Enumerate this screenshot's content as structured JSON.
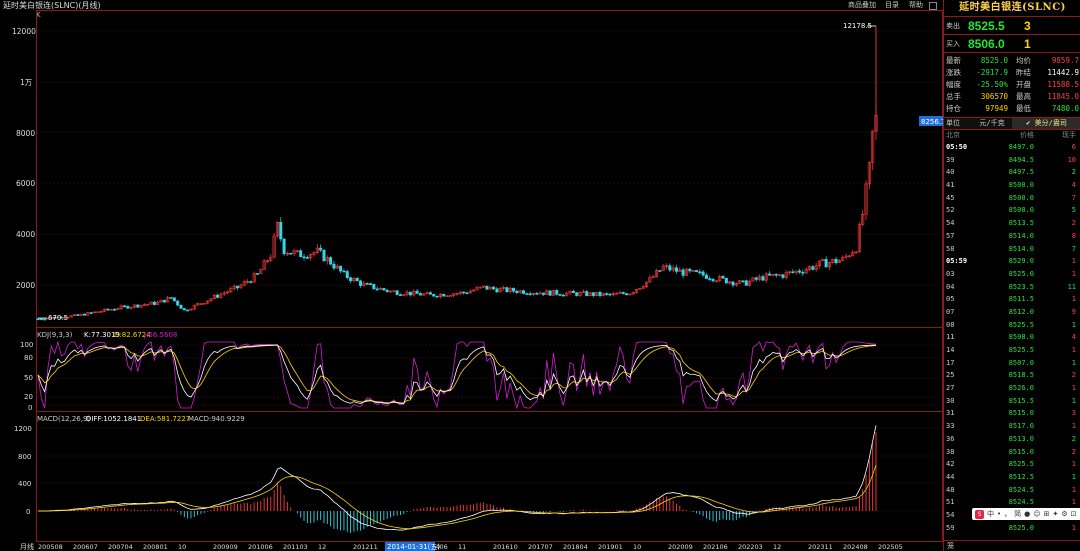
{
  "header": {
    "title": "延时美白银连(SLNC)(月线)",
    "k_label": "K",
    "links": [
      "商品叠加",
      "目录",
      "帮助"
    ]
  },
  "price_axis": {
    "labels": [
      "12000",
      "1万",
      "8000",
      "6000",
      "4000",
      "2000"
    ],
    "max_label": "12178.5",
    "min_label": "670.5",
    "current_tag": "8256.7"
  },
  "kdj": {
    "title": "KDJ(9,3,3)",
    "k": "K:77.3019",
    "d": "D:82.6724",
    "j": "J:66.5608",
    "axis": [
      "100",
      "80",
      "50",
      "20",
      "0"
    ]
  },
  "macd": {
    "title": "MACD(12,26,9)",
    "diff": "DIFF:1052.1841",
    "dea": "DEA:581.7227",
    "macd": "MACD:940.9229",
    "axis": [
      "1200",
      "800",
      "400",
      "0"
    ]
  },
  "time_axis": {
    "label": "月线",
    "ticks": [
      "200508",
      "200607",
      "200704",
      "200801",
      "10",
      "200909",
      "201006",
      "201103",
      "12",
      "201211",
      "201308",
      "201406",
      "11",
      "201610",
      "201707",
      "201804",
      "201901",
      "10",
      "202009",
      "202106",
      "202203",
      "12",
      "202311",
      "202408",
      "202505"
    ],
    "cursor": "2014-01-31(五)"
  },
  "quote": {
    "name": "延时美白银连(SLNC)",
    "sell_label": "卖出",
    "sell_price": "8525.5",
    "sell_vol": "3",
    "buy_label": "买入",
    "buy_price": "8506.0",
    "buy_vol": "1",
    "stats": [
      {
        "l": "最新",
        "v": "8525.0",
        "vc": "g",
        "l2": "均价",
        "v2": "9859.7",
        "v2c": "r"
      },
      {
        "l": "涨跌",
        "v": "-2917.9",
        "vc": "g",
        "l2": "昨结",
        "v2": "11442.9",
        "v2c": "w"
      },
      {
        "l": "幅度",
        "v": "-25.50%",
        "vc": "g",
        "l2": "开盘",
        "v2": "11588.5",
        "v2c": "r"
      },
      {
        "l": "总手",
        "v": "306570",
        "vc": "y",
        "l2": "最高",
        "v2": "11845.0",
        "v2c": "r"
      },
      {
        "l": "持仓",
        "v": "97949",
        "vc": "y",
        "l2": "最低",
        "v2": "7480.0",
        "v2c": "g"
      }
    ],
    "unit_label": "单位",
    "unit_1": "元/千克",
    "unit_2": "✔ 美分/盎司",
    "col_time": "北京",
    "col_price": "价格",
    "col_vol": "现手",
    "footer": "笼"
  },
  "ticks": [
    {
      "t": "05:50",
      "p": "8497.0",
      "v": "6",
      "b": true
    },
    {
      "t": "39",
      "p": "8494.5",
      "v": "10"
    },
    {
      "t": "40",
      "p": "8497.5",
      "v": "2"
    },
    {
      "t": "41",
      "p": "8500.0",
      "v": "4"
    },
    {
      "t": "45",
      "p": "8500.0",
      "v": "7"
    },
    {
      "t": "52",
      "p": "8500.0",
      "v": "5"
    },
    {
      "t": "54",
      "p": "8513.5",
      "v": "2"
    },
    {
      "t": "57",
      "p": "8514.0",
      "v": "8"
    },
    {
      "t": "58",
      "p": "8514.0",
      "v": "7"
    },
    {
      "t": "05:59",
      "p": "8529.0",
      "v": "1",
      "b": true
    },
    {
      "t": "03",
      "p": "8525.0",
      "v": "1"
    },
    {
      "t": "04",
      "p": "8523.5",
      "v": "11"
    },
    {
      "t": "05",
      "p": "8511.5",
      "v": "1"
    },
    {
      "t": "07",
      "p": "8512.0",
      "v": "9"
    },
    {
      "t": "08",
      "p": "8525.5",
      "v": "1"
    },
    {
      "t": "11",
      "p": "8508.0",
      "v": "4"
    },
    {
      "t": "14",
      "p": "8525.5",
      "v": "1"
    },
    {
      "t": "17",
      "p": "8507.0",
      "v": "1"
    },
    {
      "t": "25",
      "p": "8518.5",
      "v": "2"
    },
    {
      "t": "27",
      "p": "8526.0",
      "v": "1"
    },
    {
      "t": "30",
      "p": "8515.5",
      "v": "1"
    },
    {
      "t": "31",
      "p": "8515.0",
      "v": "3"
    },
    {
      "t": "33",
      "p": "8517.0",
      "v": "1"
    },
    {
      "t": "36",
      "p": "8513.0",
      "v": "2"
    },
    {
      "t": "38",
      "p": "8515.0",
      "v": "2"
    },
    {
      "t": "42",
      "p": "8525.5",
      "v": "1"
    },
    {
      "t": "44",
      "p": "8512.5",
      "v": "1"
    },
    {
      "t": "48",
      "p": "8524.5",
      "v": "1"
    },
    {
      "t": "51",
      "p": "8524.5",
      "v": "1"
    },
    {
      "t": "54",
      "p": "8524.0",
      "v": "1"
    },
    {
      "t": "59",
      "p": "8525.0",
      "v": "1"
    }
  ],
  "floatbar": {
    "items": [
      "中",
      "•",
      "，",
      "简",
      "●",
      "☺",
      "⊞",
      "✦",
      "⚙",
      "⊡"
    ]
  },
  "colors": {
    "up": "#ff3c3c",
    "down": "#33d6e8",
    "k": "#ffffff",
    "d": "#ffd200",
    "j": "#d020d0",
    "grid": "#8a1a1a"
  }
}
